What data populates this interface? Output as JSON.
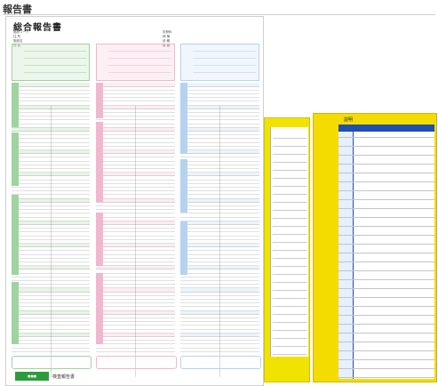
{
  "page": {
    "heading": "報告書"
  },
  "report": {
    "title": "総合報告書",
    "meta_lines": [
      "施設コード",
      "住 所",
      "施設名",
      "氏 名"
    ],
    "meta_lines_right": [
      "診療科",
      "病 棟",
      "依 頼",
      "検 査"
    ],
    "footer_text": "検査報告書"
  },
  "colors": {
    "green": "#9fd3a0",
    "pink": "#f2b6cf",
    "blue": "#b5d3f0",
    "yellow": "#f4dc00",
    "navy": "#1f4fb0"
  },
  "side_sheets": {
    "right_title": "説明"
  }
}
